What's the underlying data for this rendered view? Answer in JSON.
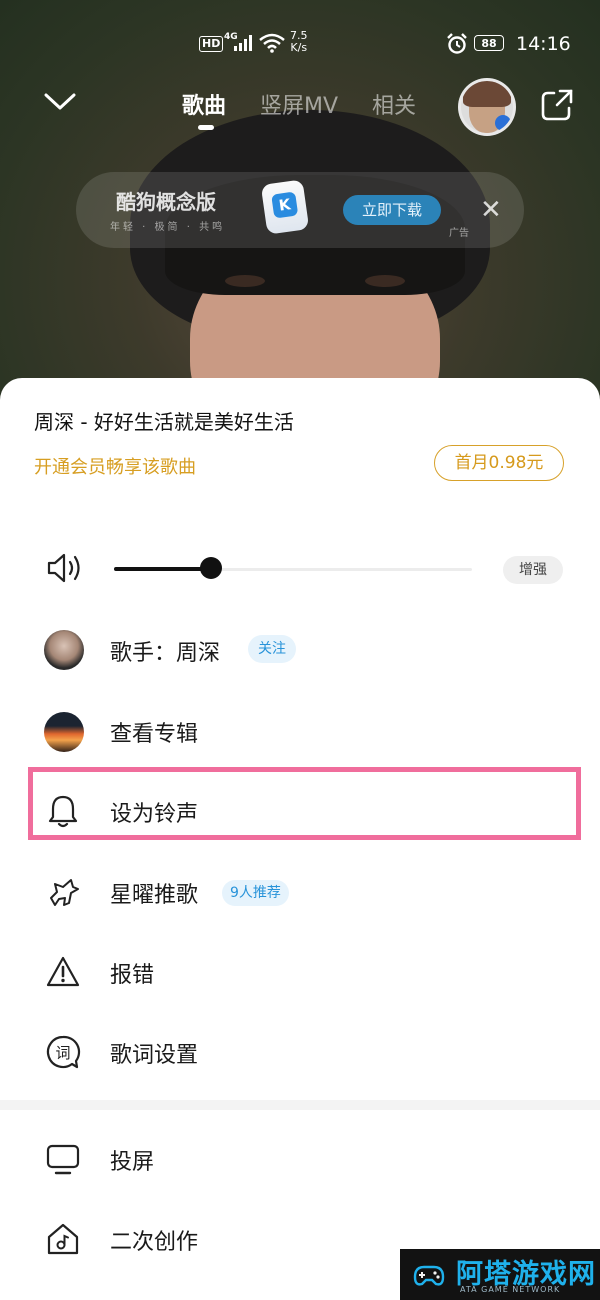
{
  "status_bar": {
    "hd": "HD",
    "network": "4G",
    "speed_value": "7.5",
    "speed_unit": "K/s",
    "battery": "88",
    "time": "14:16"
  },
  "nav": {
    "tabs": [
      {
        "label": "歌曲",
        "active": true
      },
      {
        "label": "竖屏MV",
        "active": false
      },
      {
        "label": "相关",
        "active": false
      }
    ]
  },
  "ad": {
    "title": "酷狗概念版",
    "subtitle": "年轻 · 极简 · 共鸣",
    "logo_letter": "K",
    "download_label": "立即下载",
    "tag": "广告"
  },
  "sheet": {
    "song_title": "周深 - 好好生活就是美好生活",
    "vip_text": "开通会员畅享该歌曲",
    "vip_button": "首月0.98元",
    "volume_level": 0.27,
    "enhance_label": "增强",
    "items": [
      {
        "label": "歌手：周深",
        "badge": "关注"
      },
      {
        "label": "查看专辑"
      },
      {
        "label": "设为铃声"
      },
      {
        "label": "星曜推歌",
        "badge": "9人推荐"
      },
      {
        "label": "报错"
      },
      {
        "label": "歌词设置"
      },
      {
        "label": "投屏"
      },
      {
        "label": "二次创作"
      }
    ]
  },
  "watermark": {
    "title": "阿塔游戏网",
    "subtitle": "ATA GAME NETWORK"
  },
  "colors": {
    "vip_gold": "#d79e22",
    "badge_blue": "#2893d9",
    "highlight_pink": "#f06d9c"
  }
}
